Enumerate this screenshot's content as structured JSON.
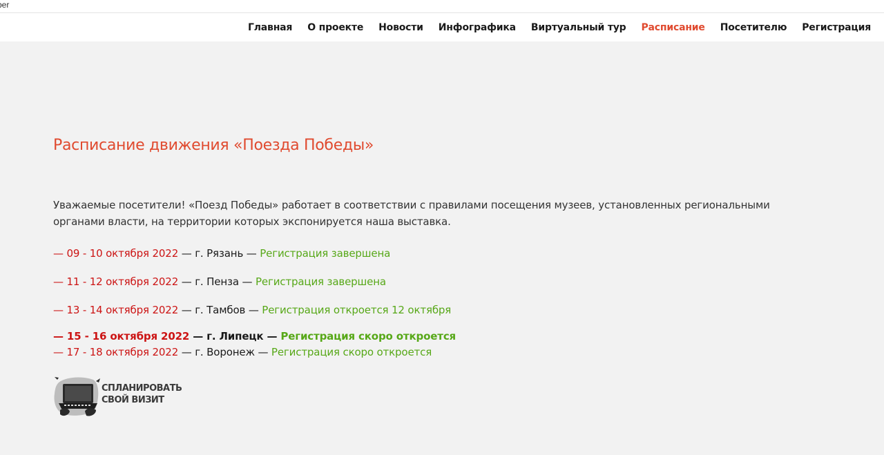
{
  "browser": {
    "tab_fragment": "ber"
  },
  "nav": {
    "items": [
      {
        "label": "Главная",
        "active": false
      },
      {
        "label": "О проекте",
        "active": false
      },
      {
        "label": "Новости",
        "active": false
      },
      {
        "label": "Инфографика",
        "active": false
      },
      {
        "label": "Виртуальный тур",
        "active": false
      },
      {
        "label": "Расписание",
        "active": true
      },
      {
        "label": "Посетителю",
        "active": false
      },
      {
        "label": "Регистрация",
        "active": false
      }
    ]
  },
  "main": {
    "title": "Расписание движения «Поезда Победы»",
    "intro": "Уважаемые посетители! «Поезд Победы» работает в соответствии с правилами посещения музеев, установленных региональными органами власти, на территории которых экспонируется наша выставка.",
    "schedule": [
      {
        "dates": "— 09 - 10 октября 2022",
        "city": " — г. Рязань — ",
        "status": "Регистрация завершена",
        "bold": false
      },
      {
        "dates": "— 11 - 12 октября 2022",
        "city": " — г. Пенза — ",
        "status": "Регистрация завершена",
        "bold": false
      },
      {
        "dates": "— 13 - 14 октября 2022",
        "city": " — г. Тамбов — ",
        "status": "Регистрация откроется 12 октября",
        "bold": false
      },
      {
        "dates": "— 15 - 16 октября 2022",
        "city": " — г. Липецк — ",
        "status": "Регистрация скоро откроется",
        "bold": true
      },
      {
        "dates": "— 17 - 18 октября 2022",
        "city": " — г. Воронеж — ",
        "status": "Регистрация скоро откроется",
        "bold": false
      }
    ],
    "plan_visit": {
      "line1": "СПЛАНИРОВАТЬ",
      "line2": "СВОЙ ВИЗИТ",
      "icon": "laptop-hands-icon"
    }
  },
  "colors": {
    "accent": "#e04a2f",
    "date_red": "#cc1414",
    "status_green": "#57a818",
    "background": "#f2f2f2"
  }
}
